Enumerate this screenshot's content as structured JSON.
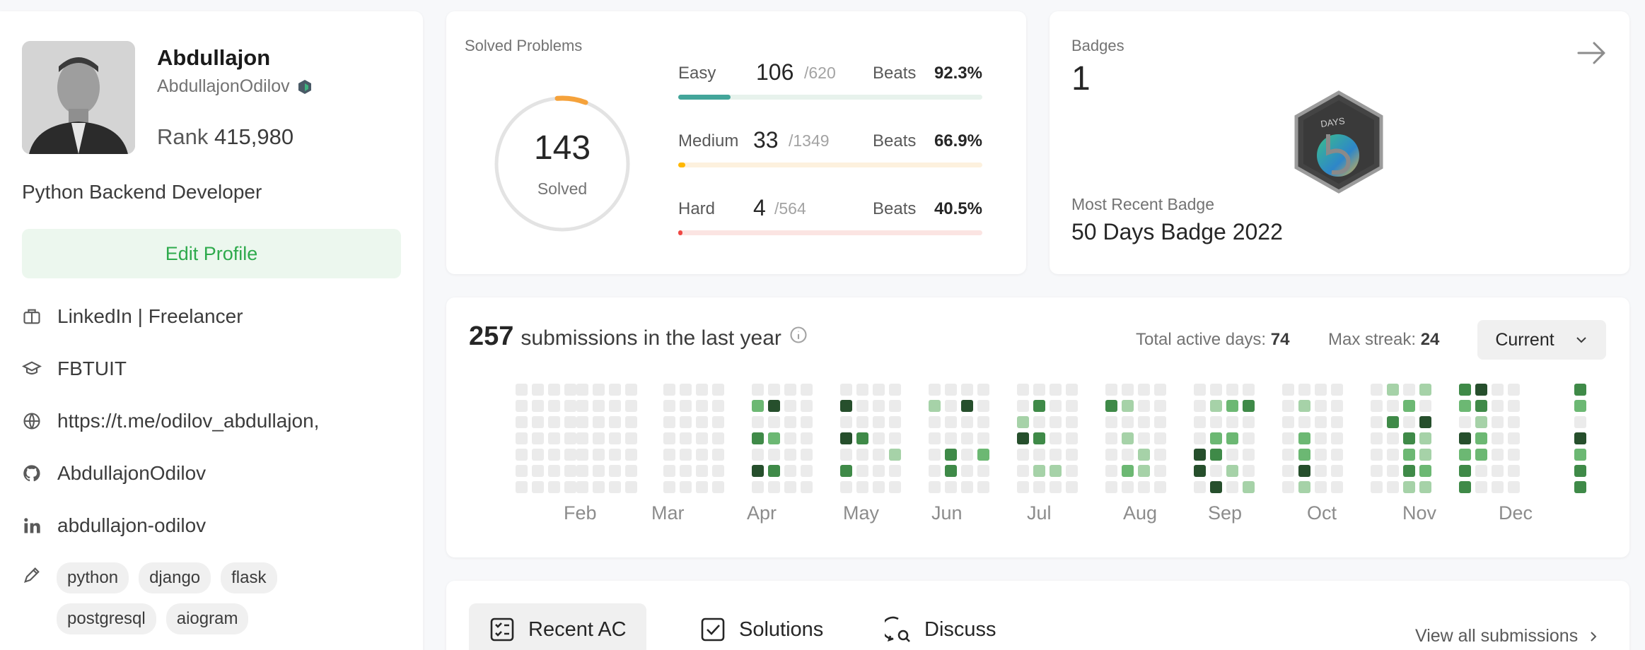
{
  "profile": {
    "name": "Abdullajon",
    "username": "AbdullajonOdilov",
    "rank_label": "Rank",
    "rank_value": "415,980",
    "bio": "Python Backend Developer",
    "edit_label": "Edit Profile",
    "info": [
      {
        "icon": "briefcase-icon",
        "text": "LinkedIn | Freelancer"
      },
      {
        "icon": "graduation-cap-icon",
        "text": "FBTUIT"
      },
      {
        "icon": "globe-icon",
        "text": "https://t.me/odilov_abdullajon,"
      },
      {
        "icon": "github-icon",
        "text": "AbdullajonOdilov"
      },
      {
        "icon": "linkedin-icon",
        "text": "abdullajon-odilov"
      }
    ],
    "tags_icon": "pencil-icon",
    "tags": [
      "python",
      "django",
      "flask",
      "postgresql",
      "aiogram"
    ]
  },
  "solved": {
    "title": "Solved Problems",
    "total": "143",
    "total_label": "Solved",
    "beats_label": "Beats",
    "difficulties": [
      {
        "label": "Easy",
        "count": "106",
        "total": "/620",
        "beats": "92.3%",
        "fraction": 0.171,
        "color": "#43a59a",
        "track": "#e7f2ec"
      },
      {
        "label": "Medium",
        "count": "33",
        "total": "/1349",
        "beats": "66.9%",
        "fraction": 0.024,
        "color": "#ffb700",
        "track": "#fdf1de"
      },
      {
        "label": "Hard",
        "count": "4",
        "total": "/564",
        "beats": "40.5%",
        "fraction": 0.007,
        "color": "#ef4743",
        "track": "#fbe4e2"
      }
    ]
  },
  "badges": {
    "title": "Badges",
    "count": "1",
    "badge_text": "DAYS",
    "recent_label": "Most Recent Badge",
    "recent_name": "50 Days Badge 2022"
  },
  "calendar": {
    "count": "257",
    "label": "submissions in the last year",
    "active_days_label": "Total active days:",
    "active_days": "74",
    "streak_label": "Max streak:",
    "streak": "24",
    "selector": "Current",
    "months": [
      "Feb",
      "Mar",
      "Apr",
      "May",
      "Jun",
      "Jul",
      "Aug",
      "Sep",
      "Oct",
      "Nov",
      "Dec"
    ],
    "colors": {
      "empty": "#ebebeb",
      "l1": "#a6d2a8",
      "l2": "#6cb873",
      "l3": "#3f8a48",
      "l4": "#264f2c"
    }
  },
  "tabs": {
    "items": [
      {
        "label": "Recent AC",
        "icon": "checklist-icon"
      },
      {
        "label": "Solutions",
        "icon": "checkbox-icon"
      },
      {
        "label": "Discuss",
        "icon": "discuss-icon"
      }
    ],
    "view_all": "View all submissions"
  }
}
